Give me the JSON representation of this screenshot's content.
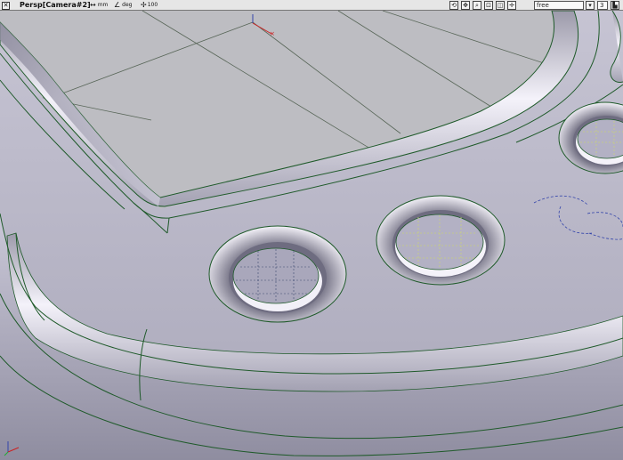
{
  "window": {
    "view_name": "Persp[Camera#2]",
    "length_unit": "mm",
    "angle_unit": "deg",
    "zoom_value": "100",
    "camera_mode": "free",
    "field_value": "3"
  },
  "icons": {
    "close": "close-icon",
    "length": "ruler-icon",
    "angle": "angle-icon",
    "zoom": "zoom-icon",
    "toolbar": [
      "tumble-icon",
      "track-icon",
      "dolly-icon",
      "zoom-box-icon",
      "fit-icon",
      "move-icon"
    ]
  },
  "colors": {
    "background": "#bdbdc2",
    "surface": "#b8b6c6",
    "edge": "#1f5a2a",
    "grid": "#556a55",
    "accent_red": "#cc2222",
    "accent_blue": "#3344aa"
  }
}
